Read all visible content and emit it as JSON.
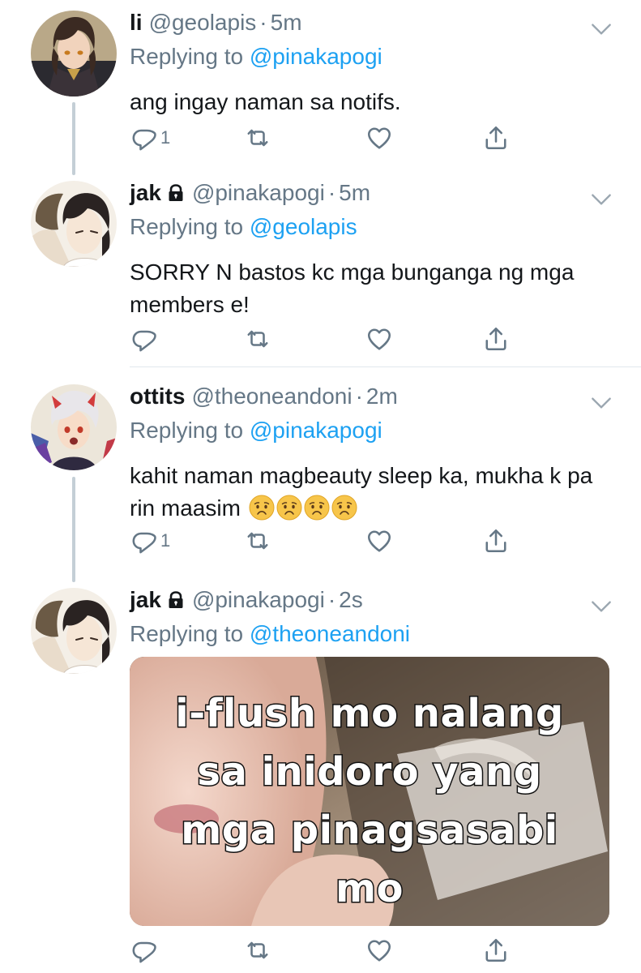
{
  "colors": {
    "text": "#14171a",
    "secondary": "#657786",
    "link": "#1da1f2",
    "divider": "#e1e8ed"
  },
  "tweets": [
    {
      "name": "li",
      "handle": "@geolapis",
      "separator": "·",
      "time": "5m",
      "reply_prefix": "Replying to",
      "reply_to": "@pinakapogi",
      "text": "ang ingay naman sa notifs.",
      "reply_count": "1",
      "avatar_icon": "anime-character-avatar"
    },
    {
      "name": "jak",
      "protected": true,
      "handle": "@pinakapogi",
      "separator": "·",
      "time": "5m",
      "reply_prefix": "Replying to",
      "reply_to": "@geolapis",
      "text": "SORRY N bastos kc mga bunganga ng mga members e!",
      "reply_count": "",
      "avatar_icon": "manhwa-character-avatar"
    },
    {
      "name": "ottits",
      "handle": "@theoneandoni",
      "separator": "·",
      "time": "2m",
      "reply_prefix": "Replying to",
      "reply_to": "@pinakapogi",
      "text": "kahit naman magbeauty sleep ka, mukha k pa rin maasim",
      "emojis": [
        "worried-face",
        "worried-face",
        "worried-face",
        "worried-face"
      ],
      "reply_count": "1",
      "avatar_icon": "anime-character-avatar"
    },
    {
      "name": "jak",
      "protected": true,
      "handle": "@pinakapogi",
      "separator": "·",
      "time": "2s",
      "reply_prefix": "Replying to",
      "reply_to": "@theoneandoni",
      "media_text_lines": [
        "i-flush mo nalang",
        "sa inidoro yang",
        "mga pinagsasabi",
        "mo"
      ],
      "reply_count": "",
      "avatar_icon": "manhwa-character-avatar"
    }
  ]
}
